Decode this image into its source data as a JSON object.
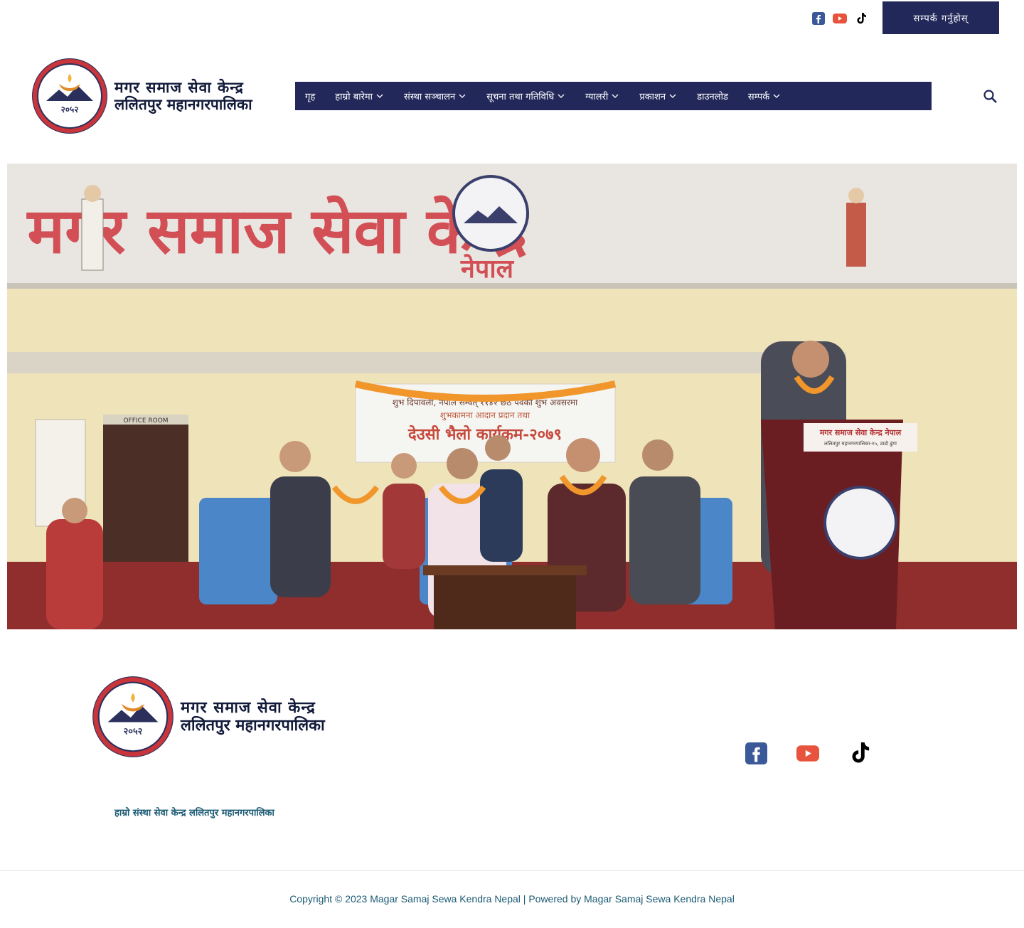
{
  "top_bar": {
    "social": [
      "facebook-icon",
      "youtube-icon",
      "tiktok-icon"
    ],
    "cta_label": "सम्पर्क गर्नुहोस्"
  },
  "header": {
    "logo": {
      "seal_number": "२०५२",
      "line1": "मगर समाज सेवा केन्द्र",
      "line2": "ललितपुर महानगरपालिका"
    },
    "nav": [
      {
        "label": "गृह",
        "has_dropdown": false
      },
      {
        "label": "हाम्रो बारेमा",
        "has_dropdown": true
      },
      {
        "label": "संस्था सञ्चालन",
        "has_dropdown": true
      },
      {
        "label": "सूचना तथा गतिविधि",
        "has_dropdown": true
      },
      {
        "label": "ग्यालरी",
        "has_dropdown": true
      },
      {
        "label": "प्रकाशन",
        "has_dropdown": true
      },
      {
        "label": "डाउनलोड",
        "has_dropdown": false
      },
      {
        "label": "सम्पर्क",
        "has_dropdown": true
      }
    ]
  },
  "hero": {
    "banner_title": "मगर समाज सेवा केन्द्र",
    "banner_sub": "नेपाल",
    "event_line1": "शुभ दिपावली, नेपाल सम्वत् ११४२ छठ पर्वको शुभ अवसरमा",
    "event_line2": "शुभकामना आदान प्रदान तथा",
    "event_title": "देउसी भैलो कार्यक्रम-२०७९",
    "podium_title": "मगर समाज सेवा केन्द्र नेपाल",
    "podium_sub": "ललितपुर महानगरपालिका-१५, ठाडो ढुंगा",
    "door_label": "OFFICE ROOM"
  },
  "footer": {
    "logo": {
      "seal_number": "२०५२",
      "line1": "मगर समाज सेवा केन्द्र",
      "line2": "ललितपुर महानगरपालिका"
    },
    "social": [
      "facebook-icon",
      "youtube-icon",
      "tiktok-icon"
    ],
    "tagline": "हाम्रो संस्था सेवा केन्द्र ललितपुर महानगरपालिका",
    "copyright": "Copyright © 2023 Magar Samaj Sewa Kendra Nepal | Powered by Magar Samaj Sewa Kendra Nepal"
  },
  "colors": {
    "brand_navy": "#22295a",
    "facebook": "#3b5998",
    "youtube": "#e8533d",
    "tiktok": "#000000",
    "link_teal": "#1a5a73"
  }
}
